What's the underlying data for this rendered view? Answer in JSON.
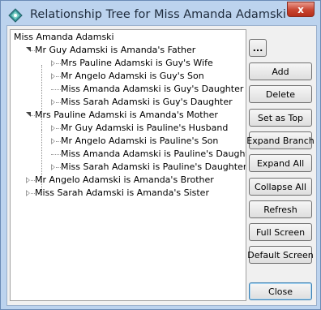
{
  "window": {
    "title": "Relationship Tree for Miss Amanda Adamski",
    "close_glyph": "x"
  },
  "tree": {
    "root": "Miss Amanda Adamski",
    "nodes": [
      "Mr Guy Adamski is Amanda's Father",
      "Mrs Pauline Adamski is Guy's Wife",
      "Mr Angelo Adamski is Guy's Son",
      "Miss Amanda Adamski is Guy's Daughter",
      "Miss Sarah Adamski is Guy's Daughter",
      "Mrs Pauline Adamski is Amanda's Mother",
      "Mr Guy Adamski is Pauline's Husband",
      "Mr Angelo Adamski is Pauline's Son",
      "Miss Amanda Adamski is Pauline's Daughter",
      "Miss Sarah Adamski is Pauline's Daughter",
      "Mr Angelo Adamski is Amanda's Brother",
      "Miss Sarah Adamski is Amanda's Sister"
    ]
  },
  "buttons": {
    "browse": "...",
    "add": "Add",
    "delete": "Delete",
    "set_as_top": "Set as Top",
    "expand_branch": "Expand Branch",
    "expand_all": "Expand All",
    "collapse_all": "Collapse All",
    "refresh": "Refresh",
    "full_screen": "Full Screen",
    "default_screen": "Default Screen",
    "close": "Close"
  },
  "icons": {
    "app": "relationship-tree-app-icon",
    "expanded": "triangle-down-icon",
    "collapsed": "triangle-right-icon"
  }
}
